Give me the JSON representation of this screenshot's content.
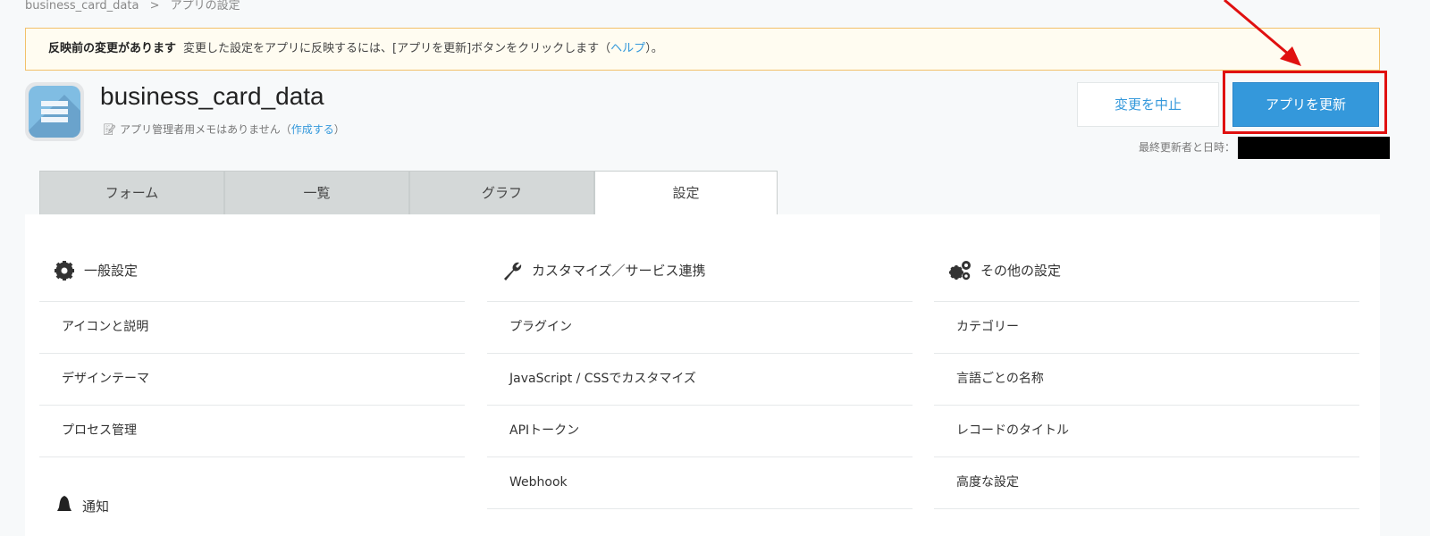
{
  "breadcrumb": {
    "app": "business_card_data",
    "separator": ">",
    "current": "アプリの設定"
  },
  "banner": {
    "title": "反映前の変更があります",
    "message": "変更した設定をアプリに反映するには、[アプリを更新]ボタンをクリックします（",
    "help": "ヘルプ",
    "suffix": "）。"
  },
  "app": {
    "name": "business_card_data",
    "memo": "アプリ管理者用メモはありません（",
    "memo_link": "作成する",
    "memo_suffix": "）"
  },
  "buttons": {
    "cancel": "変更を中止",
    "update": "アプリを更新"
  },
  "last_updated_label": "最終更新者と日時：",
  "tabs": [
    {
      "label": "フォーム"
    },
    {
      "label": "一覧"
    },
    {
      "label": "グラフ"
    },
    {
      "label": "設定",
      "active": true
    }
  ],
  "columns": [
    {
      "icon": "gear-icon",
      "title": "一般設定",
      "items": [
        "アイコンと説明",
        "デザインテーマ",
        "プロセス管理"
      ],
      "next_section": {
        "icon": "bell-icon",
        "title": "通知"
      }
    },
    {
      "icon": "wrench-icon",
      "title": "カスタマイズ／サービス連携",
      "items": [
        "プラグイン",
        "JavaScript / CSSでカスタマイズ",
        "APIトークン",
        "Webhook"
      ]
    },
    {
      "icon": "gears-icon",
      "title": "その他の設定",
      "items": [
        "カテゴリー",
        "言語ごとの名称",
        "レコードのタイトル",
        "高度な設定"
      ]
    }
  ],
  "colors": {
    "accent": "#3498db",
    "highlight": "#e01010",
    "banner_bg": "#fffcf1"
  }
}
